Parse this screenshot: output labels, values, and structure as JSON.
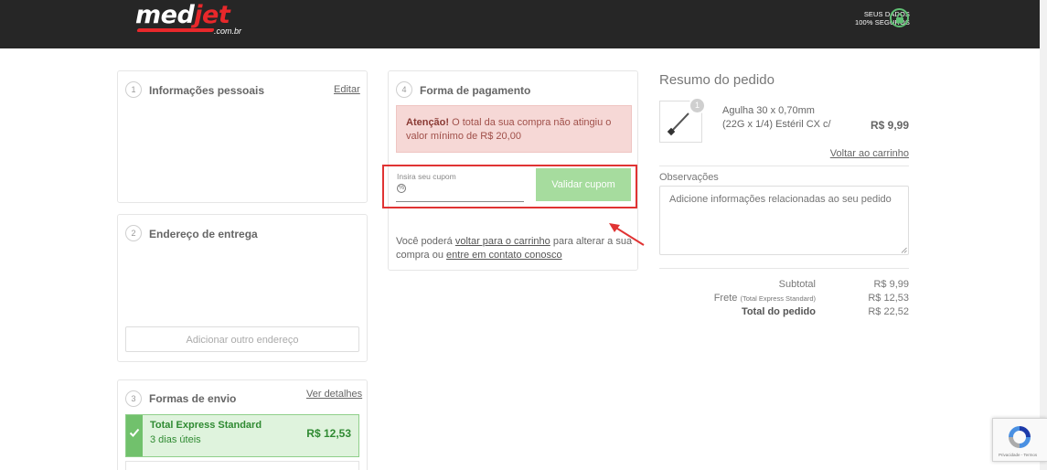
{
  "header": {
    "logo_main_a": "med",
    "logo_main_b": "jet",
    "logo_sub": ".com.br",
    "secure_line1": "SEUS DADOS",
    "secure_line2": "100% SEGUROS"
  },
  "steps": {
    "personal": {
      "number": "1",
      "title": "Informações pessoais",
      "link": "Editar"
    },
    "address": {
      "number": "2",
      "title": "Endereço de entrega",
      "button": "Adicionar outro endereço"
    },
    "shipping": {
      "number": "3",
      "title": "Formas de envio",
      "link": "Ver detalhes",
      "option": {
        "name": "Total Express Standard",
        "days": "3 dias úteis",
        "price": "R$ 12,53"
      }
    },
    "payment": {
      "number": "4",
      "title": "Forma de pagamento",
      "alert_bold": "Atenção!",
      "alert_text": " O total da sua compra não atingiu o valor mínimo de R$ 20,00",
      "coupon_label": "Insira seu cupom",
      "coupon_value": "",
      "coupon_button": "Validar cupom",
      "info_1": "Você poderá ",
      "info_link1": "voltar para o carrinho",
      "info_2": " para alterar a sua compra ou ",
      "info_link2": "entre em contato conosco"
    }
  },
  "summary": {
    "title": "Resumo do pedido",
    "product": {
      "qty": "1",
      "name_line1": "Agulha 30 x 0,70mm",
      "name_line2": "(22G x 1/4) Estéril CX c/",
      "price": "R$ 9,99"
    },
    "back_to_cart": "Voltar ao carrinho",
    "notes_label": "Observações",
    "notes_placeholder": "Adicione informações relacionadas ao seu pedido",
    "subtotal_label": "Subtotal",
    "subtotal_value": "R$ 9,99",
    "shipping_label": "Frete",
    "shipping_label_detail": "(Total Express Standard)",
    "shipping_value": "R$ 12,53",
    "total_label": "Total do pedido",
    "total_value": "R$ 22,52"
  },
  "recaptcha": {
    "text": "Privacidade - Termos"
  },
  "colors": {
    "topbar": "#262626",
    "accent_red": "#e8282b",
    "success_green": "#71c16c",
    "alert_bg": "#f6d8d6",
    "highlight_red": "#e03333"
  }
}
